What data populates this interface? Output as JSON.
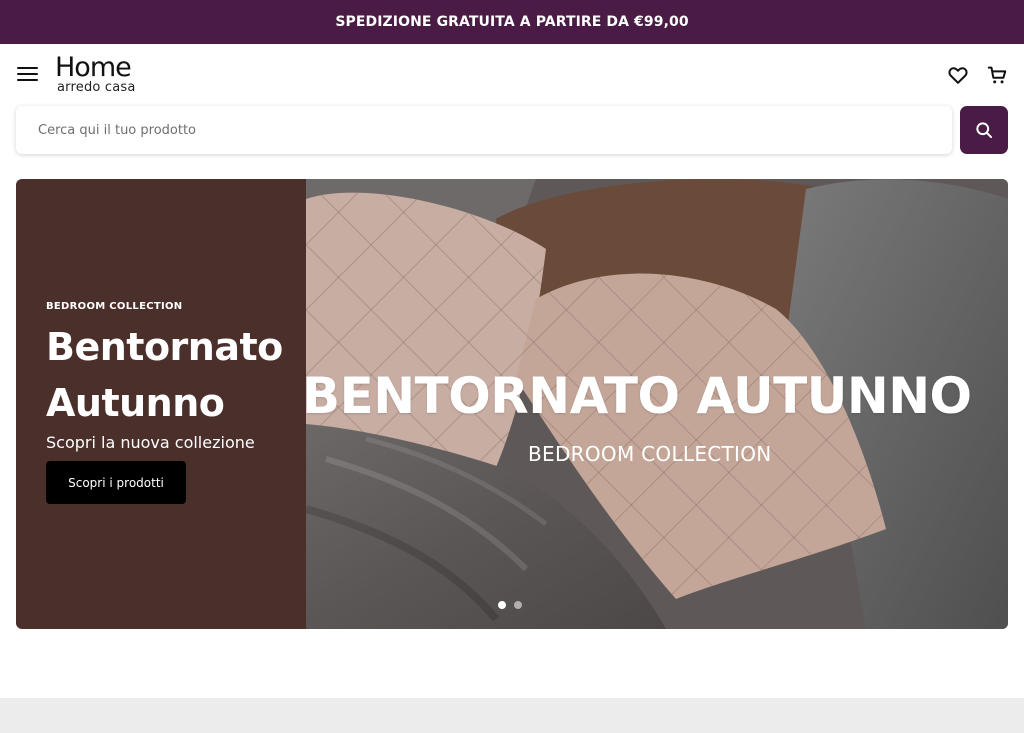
{
  "announcement": {
    "text": "SPEDIZIONE GRATUITA A PARTIRE DA €99,00"
  },
  "header": {
    "logo_word": "Home",
    "logo_sub": "arredo casa",
    "menu_icon": "hamburger-icon",
    "wishlist_icon": "heart-icon",
    "cart_icon": "cart-icon"
  },
  "search": {
    "placeholder": "Cerca qui il tuo prodotto",
    "value": "",
    "button_icon": "search-icon"
  },
  "hero": {
    "eyebrow": "BEDROOM COLLECTION",
    "title": "Bentornato Autunno",
    "subtitle": "Scopri la nuova collezione",
    "cta_label": "Scopri i prodotti",
    "image_overlay_title": "BENTORNATO AUTUNNO",
    "image_overlay_subtitle": "BEDROOM COLLECTION",
    "slides_total": 2,
    "active_slide": 1
  },
  "colors": {
    "brand": "#4a1c45",
    "hero_panel": "#4a2f2a",
    "cta": "#000000"
  }
}
